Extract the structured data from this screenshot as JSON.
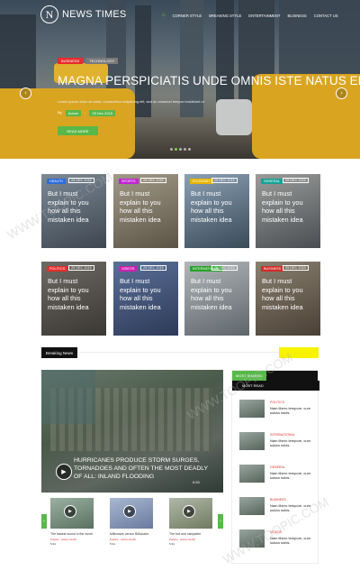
{
  "header": {
    "logo_letter": "N",
    "site_name": "NEWS TIMES",
    "nav": [
      {
        "label": "⌂",
        "active": true
      },
      {
        "label": "Corner Style",
        "active": false
      },
      {
        "label": "Breaking Style",
        "active": false
      },
      {
        "label": "Entertainment",
        "active": false
      },
      {
        "label": "Business",
        "active": false
      },
      {
        "label": "Contact us",
        "active": false
      }
    ]
  },
  "hero": {
    "tags": [
      {
        "label": "Business",
        "color": "#e62d2d"
      },
      {
        "label": "Technology",
        "color": "#7a7a7a"
      }
    ],
    "title": "MAGNA PERSPICIATIS UNDE OMNIS ISTE NATUS ERRORS",
    "subtitle": "Lorem ipsum dolor sit amet, consectetur adipiscing elit, sed do eiusmod tempor incididunt ut",
    "meta_by": "By",
    "meta_author": "Admin",
    "meta_sep": "-",
    "meta_date": "25 Dec 2015",
    "read_more": "READ MORE",
    "prev": "‹",
    "next": "›"
  },
  "grid": [
    {
      "category": "Health",
      "color": "#2f6bd9",
      "date": "25 DEC 2015",
      "text": "But I must explain to you how all this mistaken idea"
    },
    {
      "category": "Sports",
      "color": "#c026d3",
      "date": "25 DEC 2015",
      "text": "But I must explain to you how all this mistaken idea"
    },
    {
      "category": "Economy",
      "color": "#e8b400",
      "date": "25 DEC 2015",
      "text": "But I must explain to you how all this mistaken idea"
    },
    {
      "category": "General",
      "color": "#16a394",
      "date": "25 DEC 2015",
      "text": "But I must explain to you how all this mistaken idea"
    },
    {
      "category": "Politics",
      "color": "#e62d2d",
      "date": "25 DEC 2015",
      "text": "But I must explain to you how all this mistaken idea"
    },
    {
      "category": "Videos",
      "color": "#d01fb0",
      "date": "25 DEC 2015",
      "text": "But I must explain to you how all this mistaken idea"
    },
    {
      "category": "International",
      "color": "#29a329",
      "date": "25 DEC 2015",
      "text": "But I must explain to you how all this mistaken idea"
    },
    {
      "category": "Business",
      "color": "#d62a2a",
      "date": "25 DEC 2015",
      "text": "But I must explain to you how all this mistaken idea"
    }
  ],
  "breaking": {
    "label": "Breaking News"
  },
  "video": {
    "caption": "HURRICANES PRODUCE STORM SURGES, TORNADOES AND OFTEN THE MOST DEADLY OF ALL: INLAND FLOODING",
    "duration": "0:53",
    "play": "▶"
  },
  "thumbs": [
    {
      "title": "The fastest sound in the world",
      "cat": "Politics",
      "author": "Admin Smith",
      "time": "5:34"
    },
    {
      "title": "Millionaire versus Billionaire",
      "cat": "Politics",
      "author": "Admin Smith",
      "time": "5:34"
    },
    {
      "title": "The fort and campaifer",
      "cat": "Politics",
      "author": "Admin Smith",
      "time": "5:34"
    }
  ],
  "carousel": {
    "prev": "‹",
    "next": "›"
  },
  "sidebar": {
    "tab_shared": "MOST SHARED",
    "tab_read": "MOST READ",
    "items": [
      {
        "cat": "Politics",
        "headline": "Nam libero tempore, cum soluta nobis."
      },
      {
        "cat": "International",
        "headline": "Nam libero tempore, cum soluta nobis."
      },
      {
        "cat": "General",
        "headline": "Nam libero tempore, cum soluta nobis."
      },
      {
        "cat": "Business",
        "headline": "Nam libero tempore, cum soluta nobis."
      },
      {
        "cat": "Videos",
        "headline": "Nam libero tempore, cum soluta nobis."
      }
    ]
  },
  "watermark": "WWW.TOOPIC.COM"
}
